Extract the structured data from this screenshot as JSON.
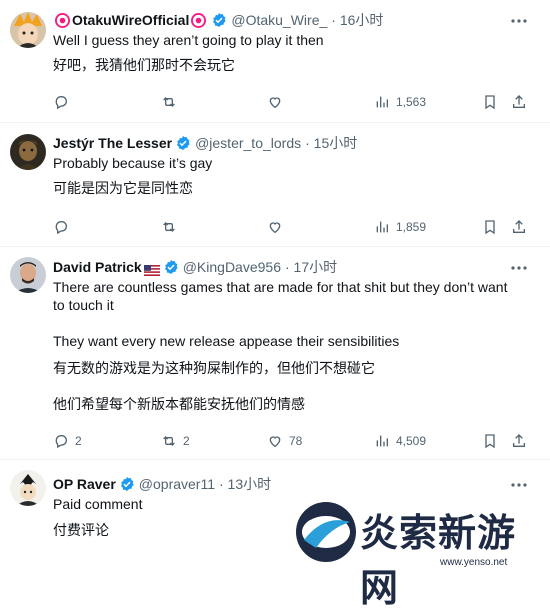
{
  "tweets": [
    {
      "display_name": "OtakuWireOfficial",
      "handle": "@Otaku_Wire_",
      "time": "· 16小时",
      "lines": [
        "Well I guess they aren’t going to play it then",
        "好吧，我猜他们那时不会玩它"
      ],
      "actions": {
        "reply": "",
        "retweet": "",
        "like": "",
        "views": "1,563"
      }
    },
    {
      "display_name": "Jestýr The Lesser",
      "handle": "@jester_to_lords",
      "time": "· 15小时",
      "lines": [
        "Probably because it’s gay",
        "可能是因为它是同性恋"
      ],
      "actions": {
        "reply": "",
        "retweet": "",
        "like": "",
        "views": "1,859"
      }
    },
    {
      "display_name": "David Patrick",
      "handle": "@KingDave956",
      "time": "· 17小时",
      "lines": [
        "There are countless games that are made for that shit but they don’t want",
        "to touch it",
        "They want every new release appease their sensibilities",
        "有无数的游戏是为这种狗屎制作的，但他们不想碰它",
        "他们希望每个新版本都能安抚他们的情感"
      ],
      "actions": {
        "reply": "2",
        "retweet": "2",
        "like": "78",
        "views": "4,509"
      }
    },
    {
      "display_name": "OP Raver",
      "handle": "@opraver11",
      "time": "· 13小时",
      "lines": [
        "Paid comment",
        "付费评论"
      ],
      "actions": {}
    }
  ],
  "watermark": {
    "text": "炎索新游网",
    "url": "www.yenso.net"
  },
  "colors": {
    "verified": "#1d9bf0",
    "secondary_text": "#536471",
    "divider": "#eff3f4",
    "pink_badge": "#f91880"
  }
}
